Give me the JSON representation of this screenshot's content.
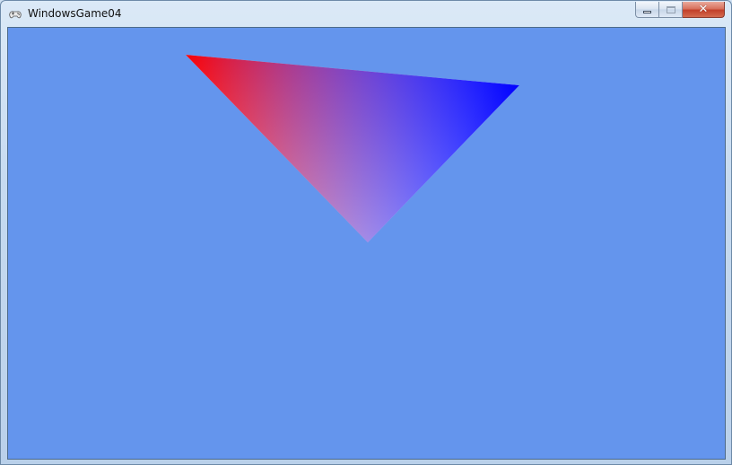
{
  "window": {
    "title": "WindowsGame04",
    "app_icon": "gamepad-icon",
    "controls": {
      "minimize_icon": "minimize-icon",
      "maximize_icon": "maximize-icon",
      "close_label": "✕"
    }
  },
  "scene": {
    "background_color": "#6495ED",
    "triangle": {
      "vertex_colors": [
        "#FF0000",
        "#0000FF",
        "#FFFFFF"
      ]
    }
  }
}
